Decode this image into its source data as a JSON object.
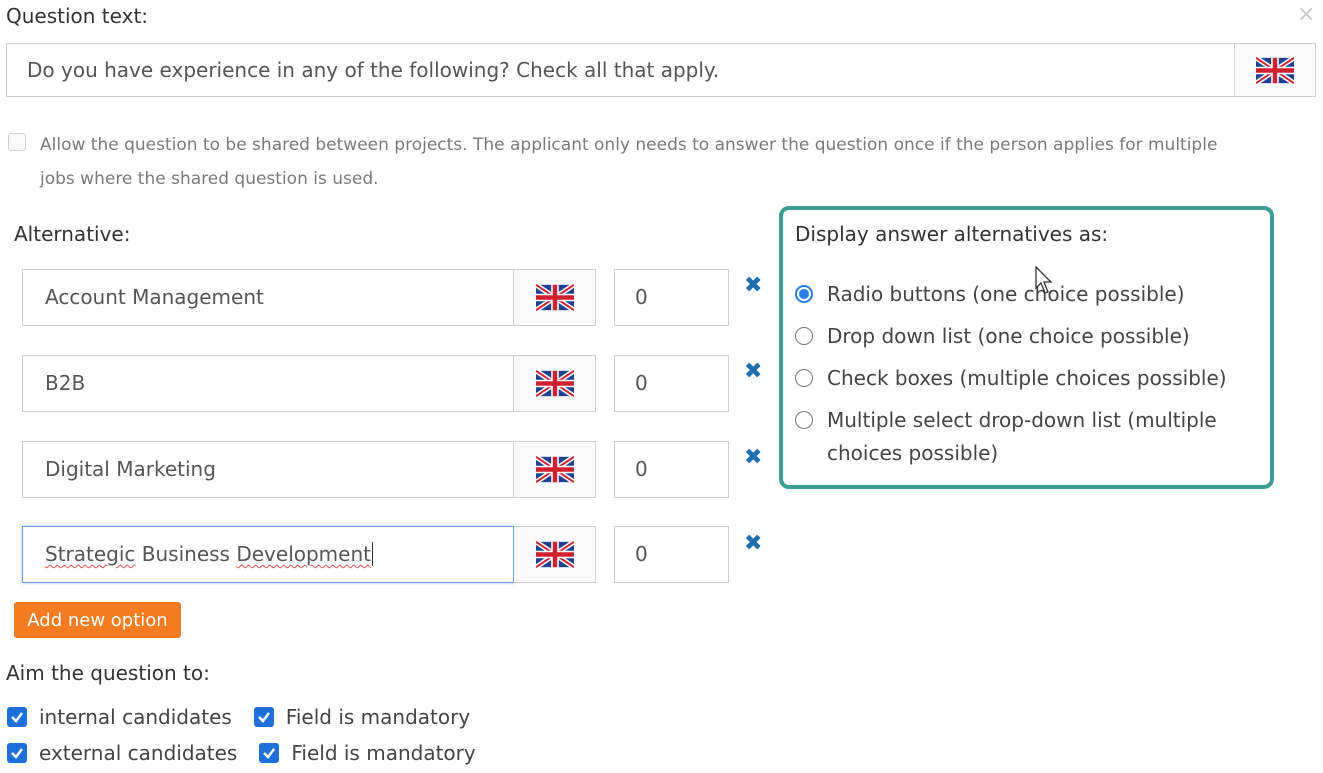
{
  "question": {
    "label": "Question text:",
    "value": "Do you have experience in any of the following? Check all that apply.",
    "language_flag": "uk-flag-icon"
  },
  "close_icon": "×",
  "share": {
    "checked": false,
    "line1": "Allow the question to be shared between projects. The applicant only needs to answer the question once if the person applies for multiple",
    "line2": "jobs where the shared question is used."
  },
  "alternatives": {
    "label": "Alternative:",
    "items": [
      {
        "text": "Account Management",
        "score": "0"
      },
      {
        "text": "B2B",
        "score": "0"
      },
      {
        "text": "Digital Marketing",
        "score": "0"
      },
      {
        "text_parts": [
          "Strategic",
          " Business ",
          "Development"
        ],
        "score": "0",
        "focused": true
      }
    ],
    "delete_icon": "✖",
    "add_button": "Add new option"
  },
  "display": {
    "title": "Display answer alternatives as:",
    "options": [
      {
        "line1": "Radio buttons (one choice possible)",
        "selected": true
      },
      {
        "line1": "Drop down list (one choice possible)",
        "selected": false
      },
      {
        "line1": "Check boxes (multiple choices possible)",
        "selected": false
      },
      {
        "line1": "Multiple select drop-down list (multiple",
        "line2": "choices possible)",
        "selected": false
      }
    ]
  },
  "aim": {
    "label": "Aim the question to:",
    "rows": [
      {
        "candidate": "internal candidates",
        "mandatory": "Field is mandatory"
      },
      {
        "candidate": "external candidates",
        "mandatory": "Field is mandatory"
      }
    ]
  },
  "colors": {
    "accent_teal": "#3a9f92",
    "button_orange": "#f47b20",
    "delete_blue": "#1f6fae",
    "checkbox_blue": "#1f6fd8"
  }
}
